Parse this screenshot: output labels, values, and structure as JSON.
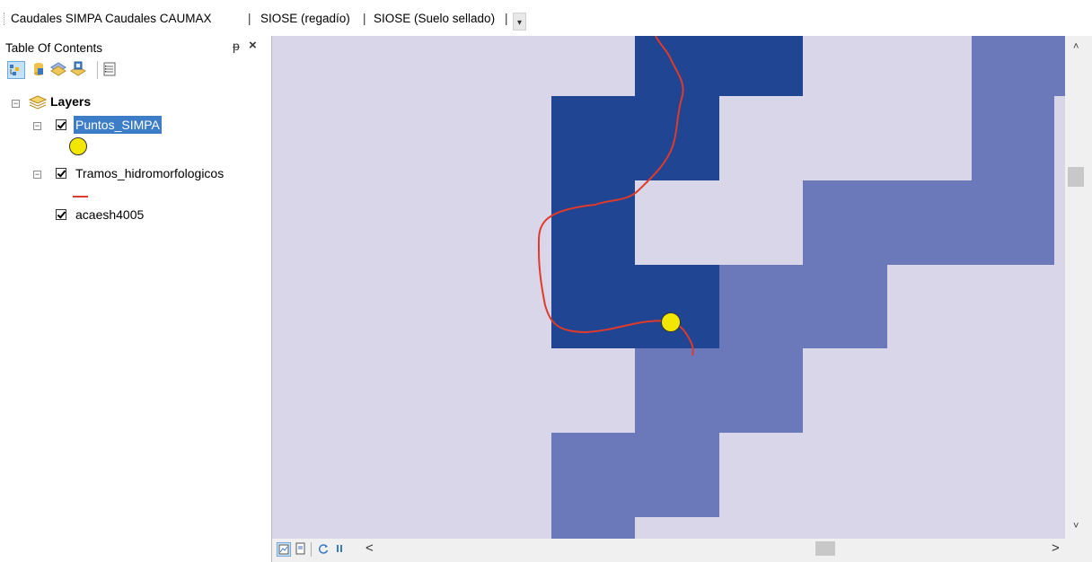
{
  "toolbar": {
    "items": [
      "Caudales SIMPA",
      "Caudales CAUMAX",
      "SIOSE (regadío)",
      "SIOSE (Suelo sellado)"
    ],
    "separator": "|"
  },
  "toc": {
    "title": "Table Of Contents",
    "pin_glyph": "ᵽ",
    "close_glyph": "×",
    "tools": [
      "list-by-drawing-order-icon",
      "list-by-source-icon",
      "list-by-visibility-icon",
      "list-by-selection-icon",
      "options-icon"
    ],
    "group_label": "Layers",
    "layers": [
      {
        "name": "Puntos_SIMPA",
        "checked": true,
        "selected": true,
        "symbol": "yellow-circle"
      },
      {
        "name": "Tramos_hidromorfologicos",
        "checked": true,
        "selected": false,
        "symbol": "red-line"
      },
      {
        "name": "acaesh4005",
        "checked": true,
        "selected": false,
        "symbol": "none"
      }
    ]
  },
  "map": {
    "colors": {
      "background": "#d9d6ea",
      "dark": "#1f4593",
      "medium": "#6b78b9",
      "river": "#e03a2a",
      "point": "#f3e600"
    }
  },
  "scrollbars": {
    "up_glyph": "˄",
    "down_glyph": "˅",
    "left_glyph": "<",
    "right_glyph": ">"
  }
}
